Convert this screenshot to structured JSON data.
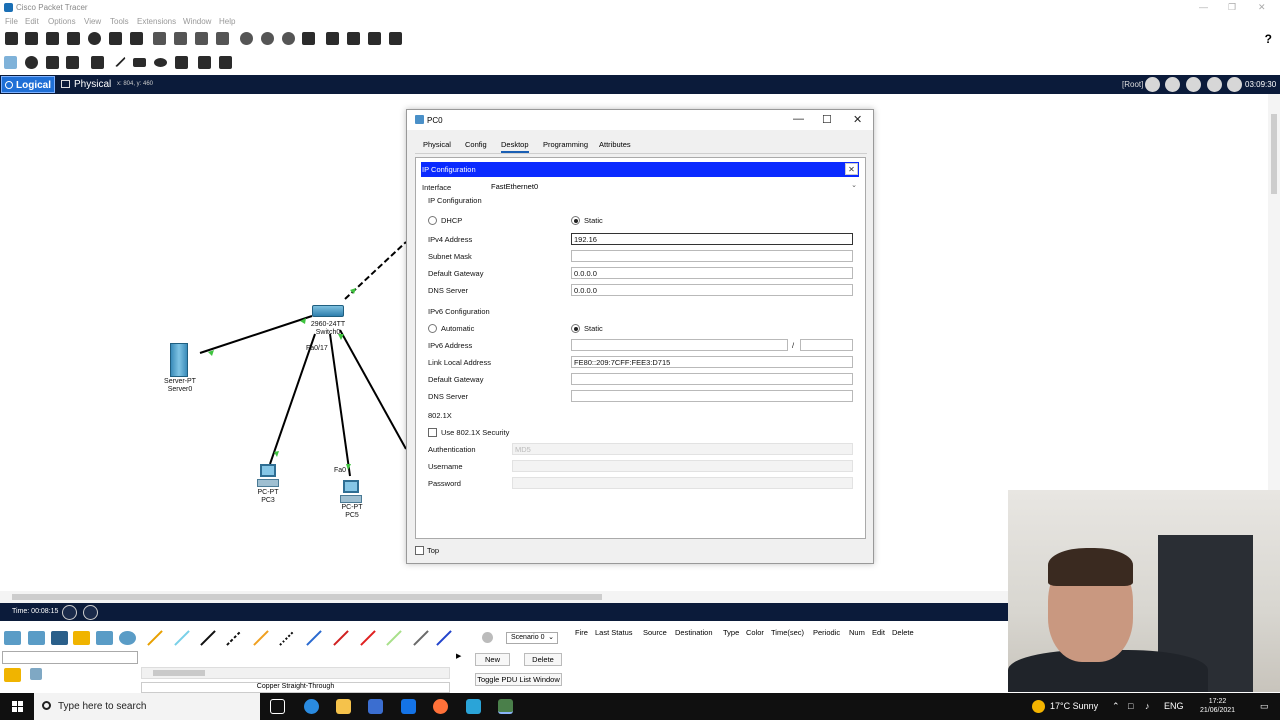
{
  "app": {
    "title": "Cisco Packet Tracer"
  },
  "menu": [
    "File",
    "Edit",
    "Options",
    "View",
    "Tools",
    "Extensions",
    "Window",
    "Help"
  ],
  "modes": {
    "logical": "Logical",
    "physical": "Physical",
    "coords": "x: 804, y: 460"
  },
  "status": {
    "root": "[Root]",
    "clock": "03:09:30"
  },
  "topology": {
    "devices": [
      {
        "name": "server",
        "line1": "Server-PT",
        "line2": "Server0"
      },
      {
        "name": "switch",
        "line1": "2960-24TT",
        "line2": "Switch0"
      },
      {
        "name": "pc3",
        "line1": "PC-PT",
        "line2": "PC3"
      },
      {
        "name": "pc5",
        "line1": "PC-PT",
        "line2": "PC5"
      }
    ],
    "port_labels": {
      "fa017": "Fa0/17",
      "fa0": "Fa0"
    }
  },
  "dialog": {
    "title": "PC0",
    "tabs": [
      "Physical",
      "Config",
      "Desktop",
      "Programming",
      "Attributes"
    ],
    "active_tab": "Desktop",
    "ip_config_title": "IP Configuration",
    "interface_label": "Interface",
    "interface_value": "FastEthernet0",
    "ipv4": {
      "section": "IP Configuration",
      "dhcp": "DHCP",
      "static": "Static",
      "selected": "Static",
      "ipv4_label": "IPv4 Address",
      "ipv4_value": "192.16",
      "subnet_label": "Subnet Mask",
      "subnet_value": "",
      "gateway_label": "Default Gateway",
      "gateway_value": "0.0.0.0",
      "dns_label": "DNS Server",
      "dns_value": "0.0.0.0"
    },
    "ipv6": {
      "section": "IPv6 Configuration",
      "automatic": "Automatic",
      "static": "Static",
      "selected": "Static",
      "ipv6_label": "IPv6 Address",
      "ipv6_value": "",
      "prefix_sep": "/",
      "prefix_value": "",
      "link_local_label": "Link Local Address",
      "link_local_value": "FE80::209:7CFF:FEE3:D715",
      "gateway_label": "Default Gateway",
      "gateway_value": "",
      "dns_label": "DNS Server",
      "dns_value": ""
    },
    "dot1x": {
      "section": "802.1X",
      "use_label": "Use 802.1X Security",
      "auth_label": "Authentication",
      "auth_value": "MD5",
      "username_label": "Username",
      "password_label": "Password"
    },
    "top_label": "Top"
  },
  "bottom": {
    "time_label": "Time: 00:08:15",
    "connection_name": "Copper Straight-Through",
    "scenario": "Scenario 0",
    "new_label": "New",
    "delete_label": "Delete",
    "toggle_label": "Toggle PDU List Window",
    "pdu_headers": [
      "Fire",
      "Last Status",
      "Source",
      "Destination",
      "Type",
      "Color",
      "Time(sec)",
      "Periodic",
      "Num",
      "Edit",
      "Delete"
    ]
  },
  "taskbar": {
    "search_placeholder": "Type here to search",
    "weather": "17°C  Sunny",
    "lang": "ENG",
    "time": "17:22",
    "date": "21/06/2021"
  },
  "colors": {
    "accent": "#1f6fd6",
    "ip_bar": "#0a2aff",
    "navbar": "#0b1b3a"
  }
}
